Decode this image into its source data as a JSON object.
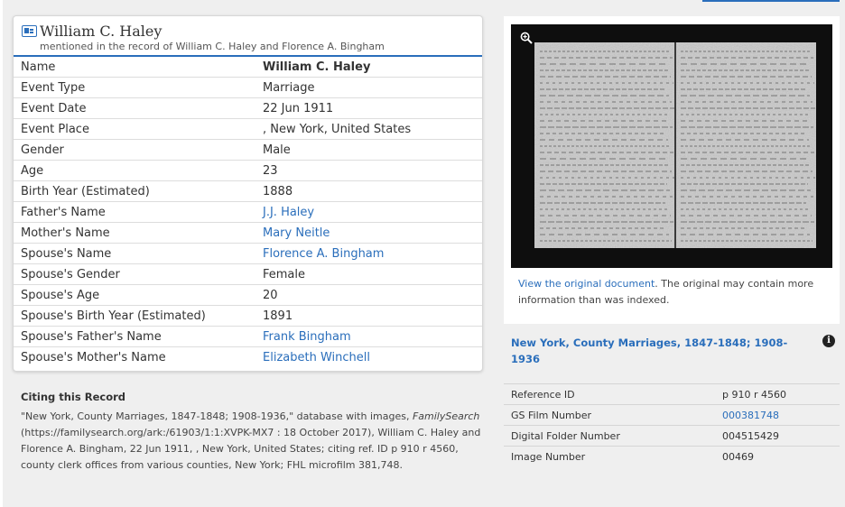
{
  "record": {
    "title": "William C. Haley",
    "subtitle": "mentioned in the record of William C. Haley and Florence A. Bingham",
    "icon": "record-card-icon",
    "facts": [
      {
        "label": "Name",
        "value": "William C. Haley",
        "link": false,
        "bold": true
      },
      {
        "label": "Event Type",
        "value": "Marriage",
        "link": false
      },
      {
        "label": "Event Date",
        "value": "22 Jun 1911",
        "link": false
      },
      {
        "label": "Event Place",
        "value": ", New York, United States",
        "link": false
      },
      {
        "label": "Gender",
        "value": "Male",
        "link": false
      },
      {
        "label": "Age",
        "value": "23",
        "link": false
      },
      {
        "label": "Birth Year (Estimated)",
        "value": "1888",
        "link": false
      },
      {
        "label": "Father's Name",
        "value": "J.J. Haley",
        "link": true
      },
      {
        "label": "Mother's Name",
        "value": "Mary Neitle",
        "link": true
      },
      {
        "label": "Spouse's Name",
        "value": "Florence A. Bingham",
        "link": true
      },
      {
        "label": "Spouse's Gender",
        "value": "Female",
        "link": false
      },
      {
        "label": "Spouse's Age",
        "value": "20",
        "link": false
      },
      {
        "label": "Spouse's Birth Year (Estimated)",
        "value": "1891",
        "link": false
      },
      {
        "label": "Spouse's Father's Name",
        "value": "Frank Bingham",
        "link": true
      },
      {
        "label": "Spouse's Mother's Name",
        "value": "Elizabeth Winchell",
        "link": true
      }
    ]
  },
  "citation": {
    "heading": "Citing this Record",
    "text_before": "\"New York, County Marriages, 1847-1848; 1908-1936,\" database with images,",
    "italic": "FamilySearch",
    "text_after": " (https://familysearch.org/ark:/61903/1:1:XVPK-MX7 : 18 October 2017), William C. Haley and Florence A. Bingham, 22 Jun 1911, , New York, United States; citing ref. ID p 910 r 4560, county clerk offices from various counties, New York; FHL microfilm 381,748."
  },
  "image_panel": {
    "zoom_icon": "zoom-in-icon",
    "view_link": "View the original document",
    "view_text": ". The original may contain more information than was indexed."
  },
  "collection": {
    "title": "New York, County Marriages, 1847-1848; 1908-1936",
    "info_icon": "info-icon"
  },
  "reference": [
    {
      "label": "Reference ID",
      "value": "p 910 r 4560",
      "link": false
    },
    {
      "label": "GS Film Number",
      "value": "000381748",
      "link": true
    },
    {
      "label": "Digital Folder Number",
      "value": "004515429",
      "link": false
    },
    {
      "label": "Image Number",
      "value": "00469",
      "link": false
    }
  ],
  "colors": {
    "accent": "#2a6ebb",
    "page_background": "#efefef",
    "card_background": "#ffffff",
    "text": "#333333"
  }
}
